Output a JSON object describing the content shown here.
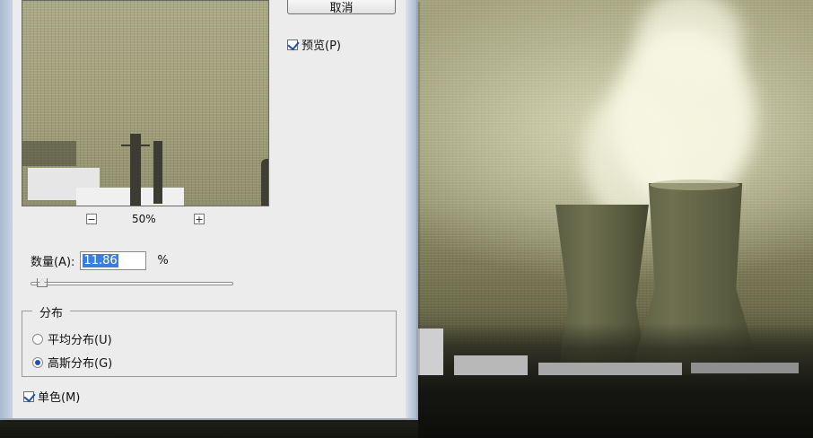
{
  "dialog": {
    "cancel_label": "取消",
    "preview_label": "预览(P)",
    "preview_checked": true,
    "zoom": {
      "minus_icon": "minus-icon",
      "plus_icon": "plus-icon",
      "level": "50%"
    },
    "amount": {
      "label": "数量(A):",
      "value": "11.86",
      "unit": "%",
      "slider_fraction": 0.0593
    },
    "distribution": {
      "title": "分布",
      "options": [
        {
          "label": "平均分布(U)",
          "selected": false
        },
        {
          "label": "高斯分布(G)",
          "selected": true
        }
      ]
    },
    "monochrome": {
      "label": "单色(M)",
      "checked": true
    }
  }
}
